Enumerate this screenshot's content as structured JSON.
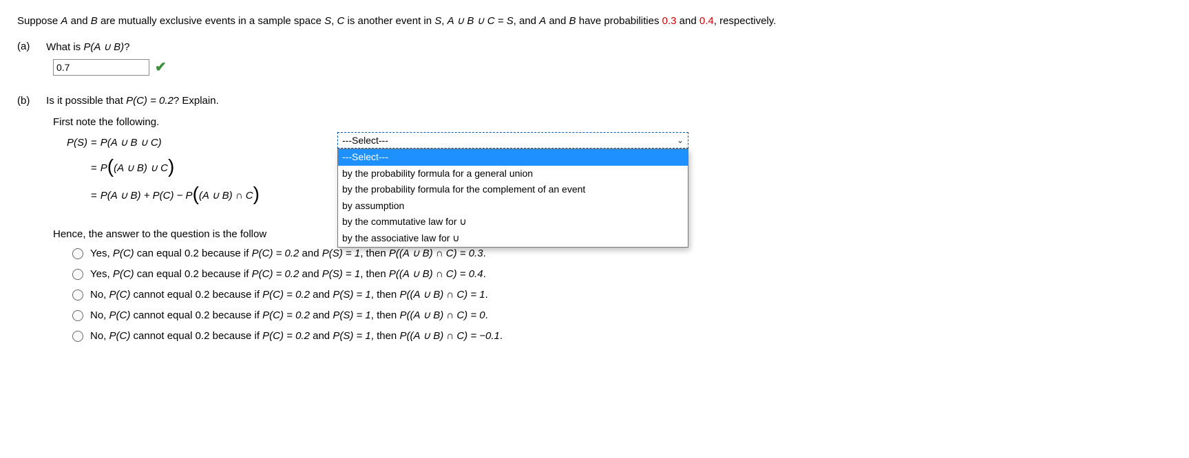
{
  "intro": {
    "p1": "Suppose ",
    "A": "A",
    "and1": " and ",
    "B": "B",
    "p2": " are mutually exclusive events in a sample space ",
    "S": "S",
    "p3": ", ",
    "C": "C",
    "p4": " is another event in ",
    "S2": "S",
    "p5": ", ",
    "eqn": "A ∪ B ∪ C = S",
    "p6": ", and ",
    "A2": "A",
    "and2": " and ",
    "B2": "B",
    "p7": " have probabilities ",
    "probA": "0.3",
    "and3": " and ",
    "probB": "0.4",
    "p8": ", respectively."
  },
  "partA": {
    "label": "(a)",
    "q1": "What is ",
    "expr": "P(A ∪ B)",
    "q2": "?",
    "answer": "0.7"
  },
  "partB": {
    "label": "(b)",
    "q1": "Is it possible that ",
    "expr": "P(C) = 0.2",
    "q2": "? Explain."
  },
  "note": "First note the following.",
  "eq": {
    "line1_lhs": "P(S)",
    "eq": "=",
    "line1_rhs": "P(A ∪ B ∪ C)",
    "line2_pref": "P",
    "line2_in": "(A ∪ B) ∪ C",
    "line3_p1": "P(A ∪ B) + P(C) − P",
    "line3_in": "(A ∪ B) ∩ C"
  },
  "dropdown": {
    "placeholder": "---Select---",
    "opt_select": "---Select---",
    "opt1": "by the probability formula for a general union",
    "opt2": "by the probability formula for the complement of an event",
    "opt3": "by assumption",
    "opt4": "by the commutative law for ∪",
    "opt5": "by the associative law for ∪"
  },
  "hence": "Hence, the answer to the question is the follow",
  "radios": {
    "r1a": "Yes, ",
    "r1b": "P(C)",
    "r1c": " can equal 0.2 because if ",
    "r1d": "P(C) = 0.2",
    "r1e": " and ",
    "r1f": "P(S) = 1",
    "r1g": ", then ",
    "r1h": "P((A ∪ B) ∩ C) = 0.3",
    "r1i": ".",
    "r2h": "P((A ∪ B) ∩ C) = 0.4",
    "r3a": "No, ",
    "r3c": " cannot equal 0.2 because if ",
    "r3h": "P((A ∪ B) ∩ C) = 1",
    "r4h": "P((A ∪ B) ∩ C) = 0",
    "r5h": "P((A ∪ B) ∩ C) = −0.1"
  }
}
